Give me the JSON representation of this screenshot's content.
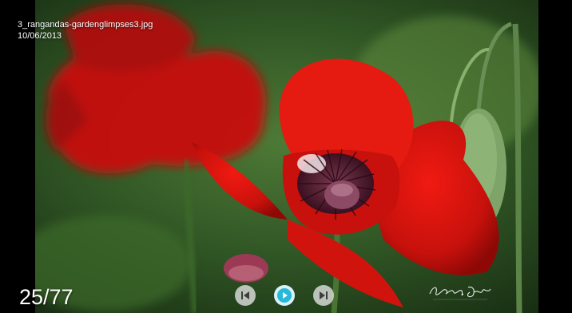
{
  "photo": {
    "filename": "3_rangandas-gardenglimpses3.jpg",
    "date": "10/06/2013",
    "subject": "red-poppy-photo"
  },
  "counter": {
    "text": "25/77",
    "current": 25,
    "total": 77
  },
  "controls": {
    "prev_icon": "skip-previous-icon",
    "play_icon": "play-icon",
    "next_icon": "skip-next-icon",
    "accent": "#29b8d8"
  },
  "watermark": {
    "text": "Rangan Das"
  }
}
